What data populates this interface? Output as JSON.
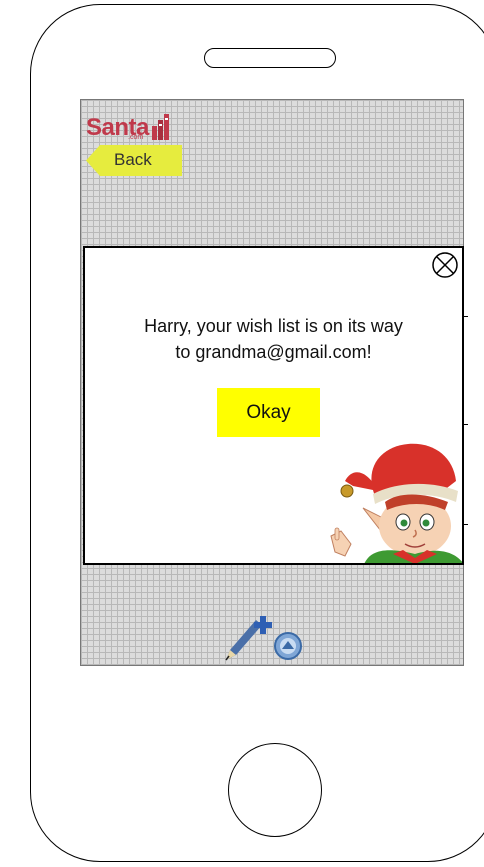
{
  "app": {
    "logo_text": "Santa",
    "logo_sub": ".com"
  },
  "nav": {
    "back_label": "Back"
  },
  "dialog": {
    "message_line1": "Harry, your wish list is on its way",
    "message_line2": "to grandma@gmail.com!",
    "okay_label": "Okay"
  },
  "icons": [
    "close-icon",
    "books-icon",
    "elf-illustration",
    "pen-icon",
    "add-icon",
    "badge-icon"
  ],
  "colors": {
    "accent_yellow": "#ffff00",
    "back_button": "#e6ec3e",
    "logo_red": "#c0394b"
  }
}
